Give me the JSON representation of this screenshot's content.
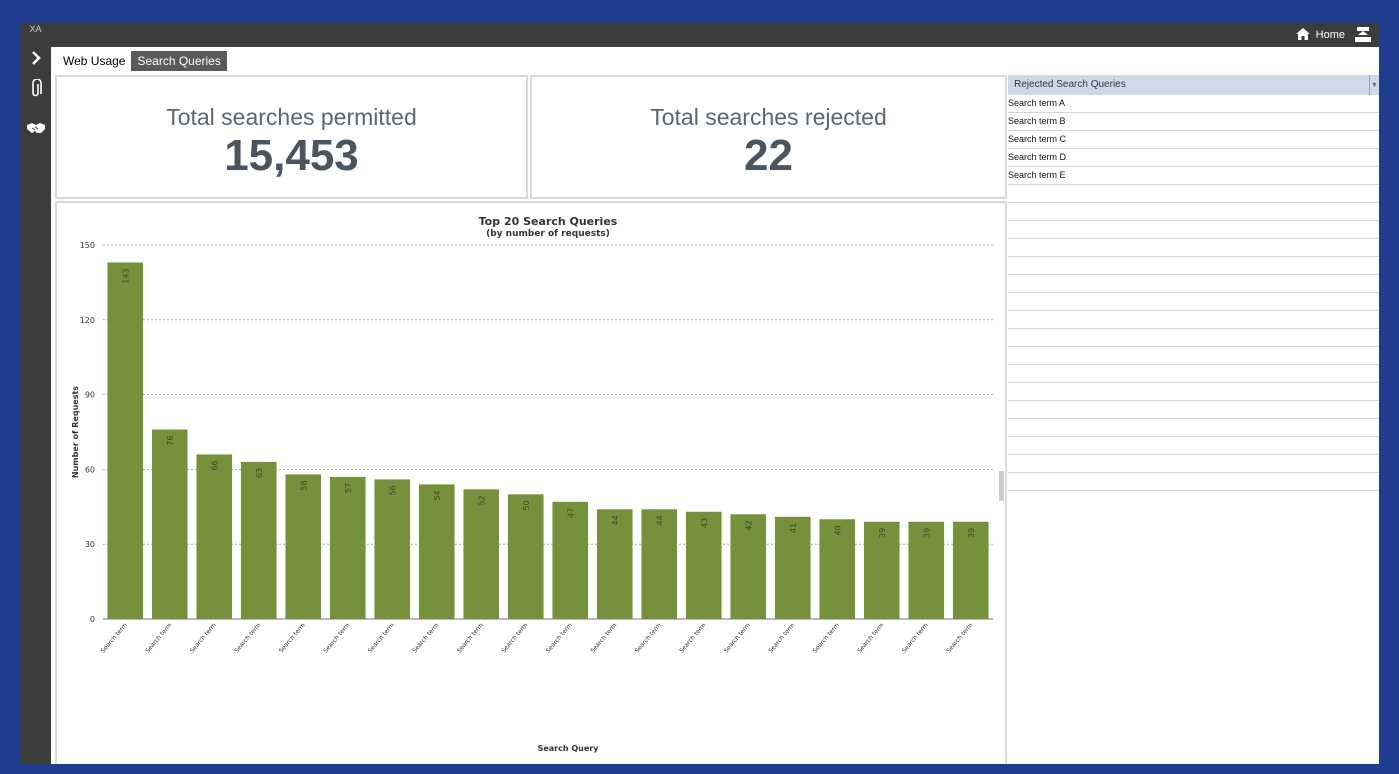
{
  "rail": {
    "logo": "XA",
    "icons": [
      "chevron-right-icon",
      "paperclip-icon",
      "handshake-icon"
    ]
  },
  "topbar": {
    "home_label": "Home"
  },
  "tabs": [
    {
      "label": "Web Usage",
      "active": false
    },
    {
      "label": "Search Queries",
      "active": true
    }
  ],
  "kpis": {
    "permitted": {
      "label": "Total searches permitted",
      "value": "15,453"
    },
    "rejected": {
      "label": "Total searches rejected",
      "value": "22"
    }
  },
  "rejected_panel": {
    "header": "Rejected Search Queries",
    "items": [
      "Search term A",
      "Search term B",
      "Search term C",
      "Search term D",
      "Search term E"
    ],
    "empty_rows": 17
  },
  "colors": {
    "bar": "#76913c",
    "frame": "#1f3d8f",
    "dark": "#3c3c3c"
  },
  "chart_data": {
    "type": "bar",
    "title": "Top 20 Search Queries",
    "subtitle": "(by number of requests)",
    "xlabel": "Search Query",
    "ylabel": "Number of Requests",
    "ylim": [
      0,
      150
    ],
    "yticks": [
      0,
      30,
      60,
      90,
      120,
      150
    ],
    "grid": true,
    "categories": [
      "Search term",
      "Search term",
      "Search term",
      "Search term",
      "Search term",
      "Search term",
      "Search term",
      "Search term",
      "Search term",
      "Search term",
      "Search term",
      "Search term",
      "Search term",
      "Search term",
      "Search term",
      "Search term",
      "Search term",
      "Search term",
      "Search term",
      "Search term"
    ],
    "values": [
      143,
      76,
      66,
      63,
      58,
      57,
      56,
      54,
      52,
      50,
      47,
      44,
      44,
      43,
      42,
      41,
      40,
      39,
      39,
      39
    ]
  }
}
